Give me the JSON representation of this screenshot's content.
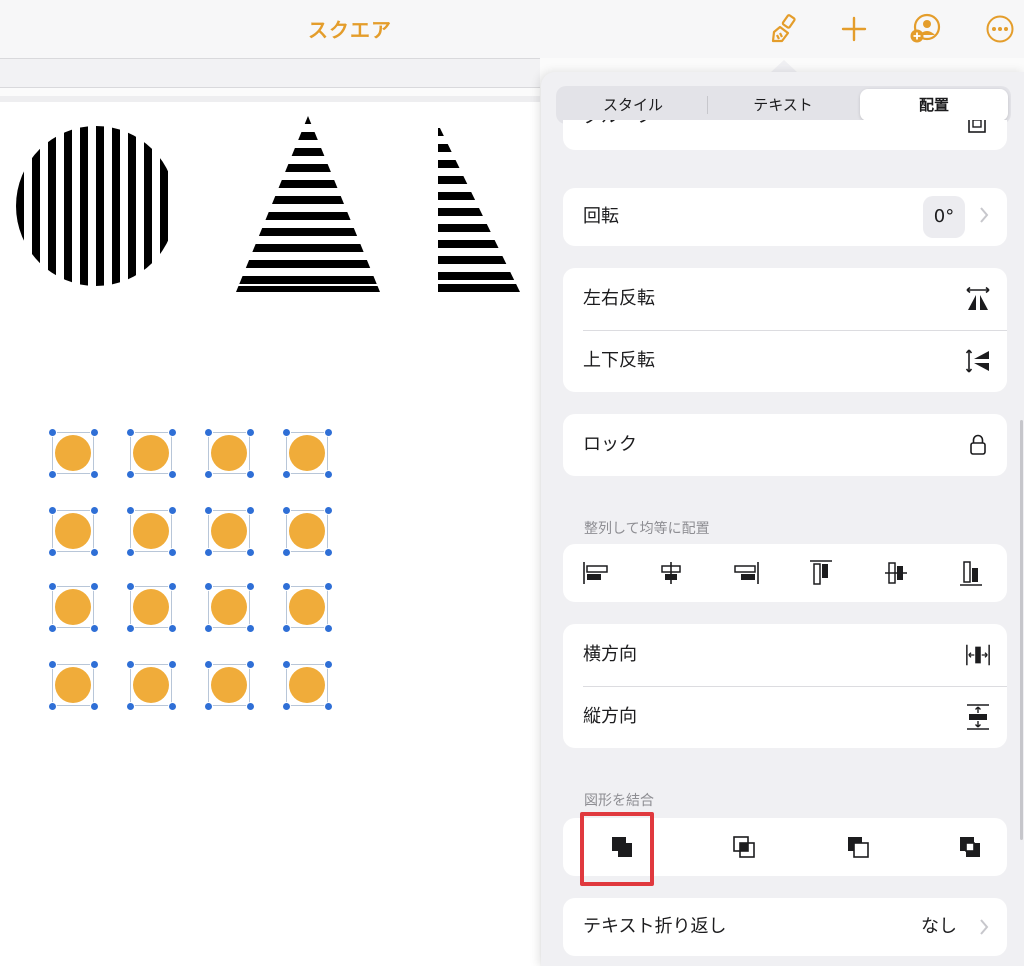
{
  "toolbar": {
    "title": "スクエア",
    "buttons": [
      "paintbrush-icon",
      "add-icon",
      "collaborate-icon",
      "more-icon"
    ],
    "accent": "#e49d2b"
  },
  "panel": {
    "tabs": [
      {
        "label": "スタイル",
        "active": false
      },
      {
        "label": "テキスト",
        "active": false
      },
      {
        "label": "配置",
        "active": true
      }
    ],
    "group_row_label": "グループ",
    "rotation": {
      "label": "回転",
      "value": "0°"
    },
    "flip": {
      "horizontal_label": "左右反転",
      "vertical_label": "上下反転"
    },
    "lock": {
      "label": "ロック"
    },
    "align_section": {
      "label": "整列して均等に配置",
      "icons": [
        "align-left-icon",
        "align-center-icon",
        "align-right-icon",
        "align-top-icon",
        "align-middle-icon",
        "align-bottom-icon"
      ]
    },
    "distribute": {
      "horizontal_label": "横方向",
      "vertical_label": "縦方向"
    },
    "combine_section": {
      "label": "図形を結合",
      "icons": [
        "unite-icon",
        "intersect-icon",
        "subtract-icon",
        "exclude-icon"
      ],
      "highlighted": "unite-icon"
    },
    "text_wrap": {
      "label": "テキスト折り返し",
      "value": "なし"
    }
  },
  "canvas": {
    "selected_shape_color": "#f0ac3a",
    "handle_color": "#2f6fd6",
    "highlight_color": "#e0393e"
  }
}
